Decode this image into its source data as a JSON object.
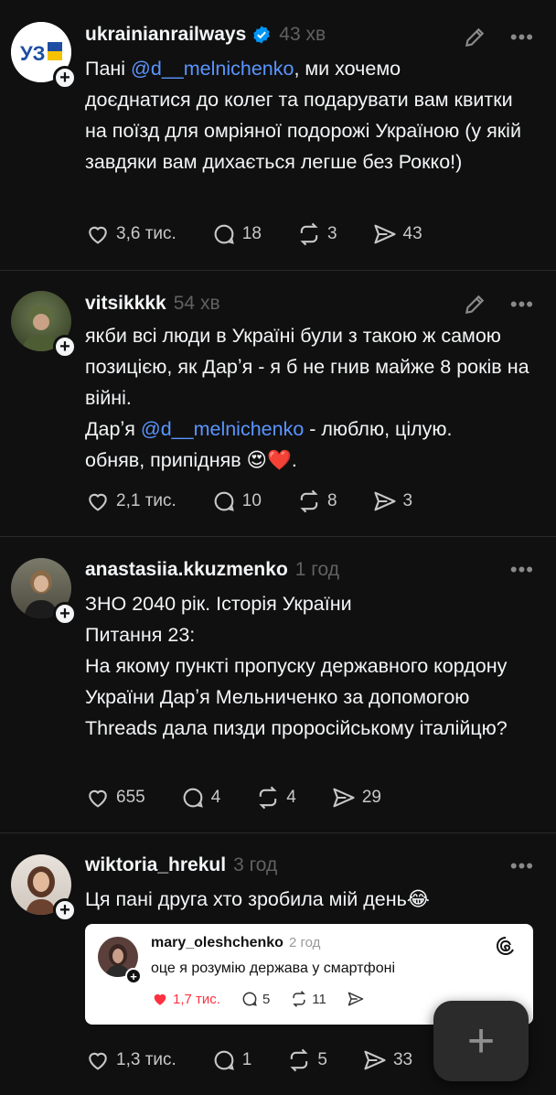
{
  "colors": {
    "background": "#101010",
    "mention": "#5a95ff",
    "verified": "#0095f6",
    "like": "#ff3040"
  },
  "posts": [
    {
      "username": "ukrainianrailways",
      "verified": true,
      "time": "43 хв",
      "avatar_text": "УЗ",
      "text_parts": {
        "l1a": "Пані ",
        "mention": "@d__melnichenko",
        "l1b": ", ми хочемо",
        "rest": "доєднатися до колег та подарувати вам квитки на поїзд для омріяної подорожі Україною (у якій завдяки вам дихається легше без Рокко!)"
      },
      "likes": "3,6 тис.",
      "replies": "18",
      "reposts": "3",
      "shares": "43"
    },
    {
      "username": "vitsikkkk",
      "time": "54 хв",
      "text_parts": {
        "p1": "якби всі люди в Україні були з такою ж самою позицією, як Дарʼя - я б не гнив майже 8 років на війні.",
        "l2a": "Дарʼя ",
        "mention": "@d__melnichenko",
        "l2b": " - люблю, цілую.",
        "l3": "обняв, припідняв 😍❤️."
      },
      "likes": "2,1 тис.",
      "replies": "10",
      "reposts": "8",
      "shares": "3"
    },
    {
      "username": "anastasiia.kkuzmenko",
      "time": "1 год",
      "lines": [
        "ЗНО 2040 рік. Історія України",
        "Питання 23:",
        "На якому пункті пропуску державного кордону України Дарʼя Мельниченко за допомогою Threads дала пизди проросійському італійцю?"
      ],
      "likes": "655",
      "replies": "4",
      "reposts": "4",
      "shares": "29"
    },
    {
      "username": "wiktoria_hrekul",
      "time": "3 год",
      "text": "Ця пані друга хто зробила мій день😂",
      "quote": {
        "username": "mary_oleshchenko",
        "time": "2 год",
        "text": "оце я розумію держава у смартфоні",
        "likes": "1,7 тис.",
        "replies": "5",
        "reposts": "11"
      },
      "likes": "1,3 тис.",
      "replies": "1",
      "reposts": "5",
      "shares": "33"
    }
  ],
  "fab": {
    "icon": "plus-icon",
    "label": "+"
  }
}
